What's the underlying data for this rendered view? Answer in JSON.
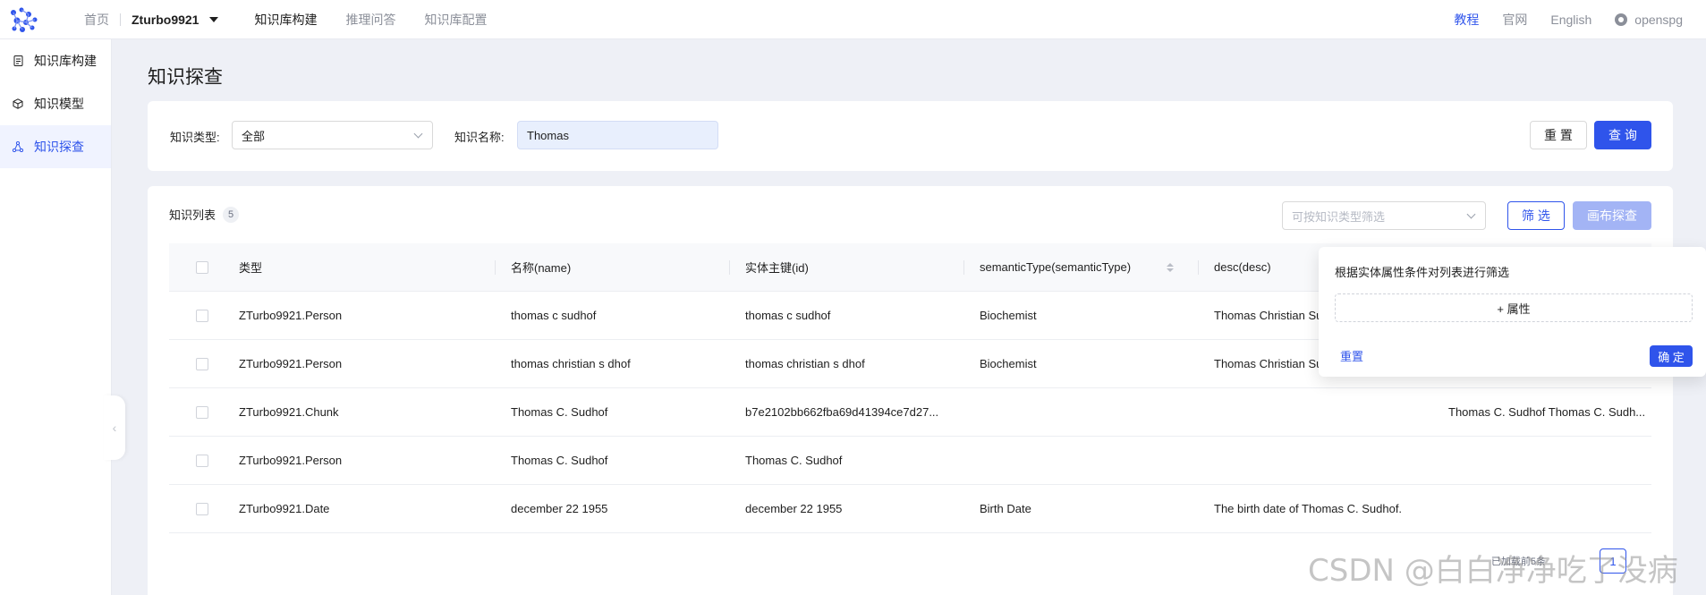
{
  "topbar": {
    "nav_home": "首页",
    "project_name": "Zturbo9921",
    "nav_build": "知识库构建",
    "nav_reasoning": "推理问答",
    "nav_config": "知识库配置",
    "link_tutorial": "教程",
    "link_official": "官网",
    "link_language": "English",
    "link_repo": "openspg"
  },
  "sidebar": {
    "items": [
      {
        "label": "知识库构建",
        "icon": "document-icon"
      },
      {
        "label": "知识模型",
        "icon": "cube-icon"
      },
      {
        "label": "知识探查",
        "icon": "graph-nodes-icon",
        "active": true
      }
    ]
  },
  "page": {
    "title": "知识探查"
  },
  "search": {
    "type_label": "知识类型:",
    "type_value": "全部",
    "name_label": "知识名称:",
    "name_value": "Thomas",
    "reset_label": "重 置",
    "query_label": "查 询"
  },
  "list": {
    "title": "知识列表",
    "count": "5",
    "filter_placeholder": "可按知识类型筛选",
    "filter_button": "筛 选",
    "canvas_button": "画布探查",
    "columns": [
      "类型",
      "名称(name)",
      "实体主键(id)",
      "semanticType(semanticType)",
      "desc(desc)"
    ],
    "rows": [
      {
        "type": "ZTurbo9921.Person",
        "name": "thomas c sudhof",
        "id": "thomas c sudhof",
        "semantic": "Biochemist",
        "desc": "Thomas Christian Sudh",
        "content": ""
      },
      {
        "type": "ZTurbo9921.Person",
        "name": "thomas christian s dhof",
        "id": "thomas christian s dhof",
        "semantic": "Biochemist",
        "desc": "Thomas Christian Sudh",
        "content": ""
      },
      {
        "type": "ZTurbo9921.Chunk",
        "name": "Thomas C. Sudhof",
        "id": "b7e2102bb662fba69d41394ce7d27...",
        "semantic": "",
        "desc": "",
        "content": "Thomas C. Sudhof Thomas C. Sudh..."
      },
      {
        "type": "ZTurbo9921.Person",
        "name": "Thomas C. Sudhof",
        "id": "Thomas C. Sudhof",
        "semantic": "",
        "desc": "",
        "content": ""
      },
      {
        "type": "ZTurbo9921.Date",
        "name": "december 22 1955",
        "id": "december 22 1955",
        "semantic": "Birth Date",
        "desc": "The birth date of Thomas C. Sudhof.",
        "content": ""
      }
    ],
    "pager_info": "已加载前5条",
    "current_page": "1"
  },
  "popover": {
    "title": "根据实体属性条件对列表进行筛选",
    "add_attribute": "+ 属性",
    "reset": "重置",
    "confirm": "确 定"
  },
  "watermark": "CSDN @白白净净吃了没病",
  "colors": {
    "primary": "#2f54eb",
    "background": "#eef0f6"
  }
}
